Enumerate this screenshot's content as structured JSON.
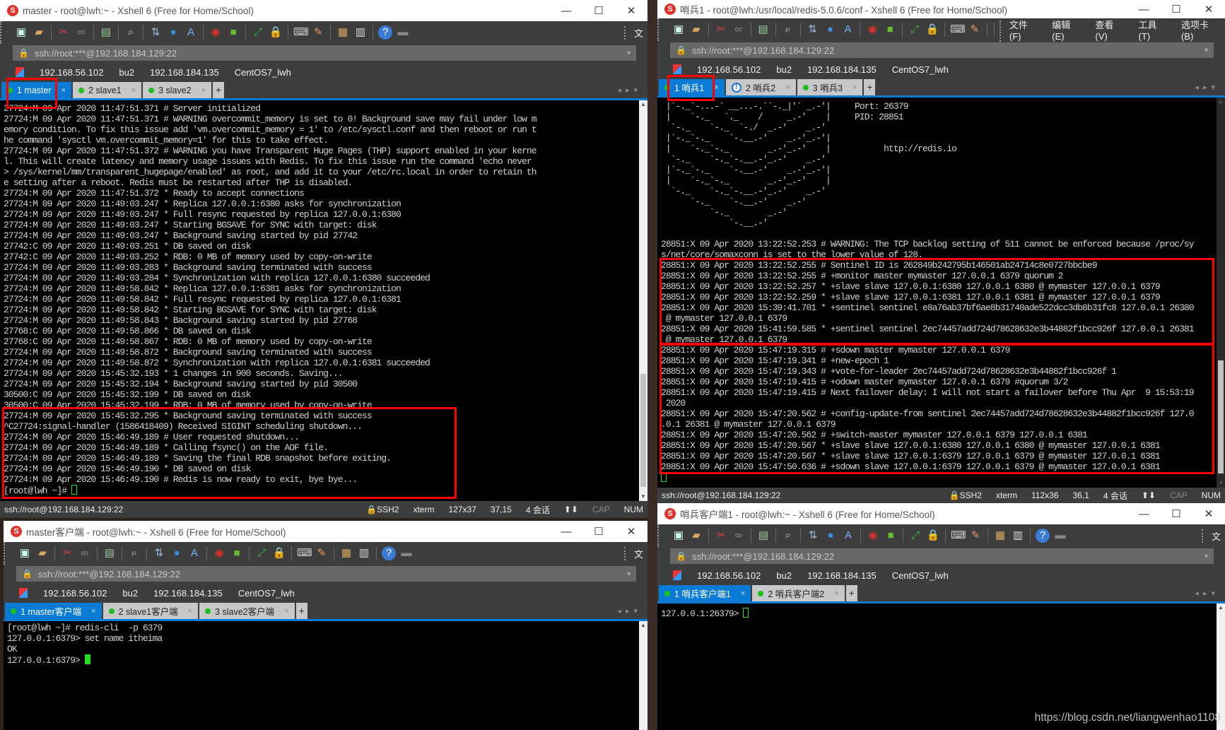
{
  "common": {
    "address": "ssh://root:***@192.168.184.129:22",
    "quick_links": [
      "192.168.56.102",
      "bu2",
      "192.168.184.135",
      "CentOS7_lwh"
    ],
    "window_buttons": {
      "minimize": "—",
      "maximize": "☐",
      "close": "✕"
    },
    "menu_truncated": "文",
    "toolbar_icons": [
      "new-session-icon",
      "open-folder-icon",
      "|",
      "disconnect-icon",
      "reconnect-icon",
      "|",
      "properties-icon",
      "|",
      "find-icon",
      "|",
      "transfer-icon",
      "globe-icon",
      "font-icon",
      "|",
      "xshell-logo-icon",
      "xftp-icon",
      "|",
      "fullscreen-icon",
      "lock-icon",
      "|",
      "keyboard-icon",
      "highlight-icon",
      "|",
      "compose-icon",
      "layout-icon",
      "|",
      "help-icon",
      "chat-icon"
    ],
    "accent_color": "#0a7bd4",
    "highlight_color": "#ff0000",
    "cursor_color": "#1ee01e"
  },
  "windows": [
    {
      "id": "win-master",
      "title": "master - root@lwh:~ - Xshell 6 (Free for Home/School)",
      "tabs": [
        {
          "label": "1 master",
          "active": true,
          "icon": "dot"
        },
        {
          "label": "2 slave1",
          "active": false,
          "icon": "dot"
        },
        {
          "label": "3 slave2",
          "active": false,
          "icon": "dot"
        }
      ],
      "lines": [
        "27724:M 09 Apr 2020 11:47:51.371 # Server initialized",
        "27724:M 09 Apr 2020 11:47:51.371 # WARNING overcommit_memory is set to 0! Background save may fail under low m",
        "emory condition. To fix this issue add 'vm.overcommit_memory = 1' to /etc/sysctl.conf and then reboot or run t",
        "he command 'sysctl vm.overcommit_memory=1' for this to take effect.",
        "27724:M 09 Apr 2020 11:47:51.372 # WARNING you have Transparent Huge Pages (THP) support enabled in your kerne",
        "l. This will create latency and memory usage issues with Redis. To fix this issue run the command 'echo never",
        "> /sys/kernel/mm/transparent_hugepage/enabled' as root, and add it to your /etc/rc.local in order to retain th",
        "e setting after a reboot. Redis must be restarted after THP is disabled.",
        "27724:M 09 Apr 2020 11:47:51.372 * Ready to accept connections",
        "27724:M 09 Apr 2020 11:49:03.247 * Replica 127.0.0.1:6380 asks for synchronization",
        "27724:M 09 Apr 2020 11:49:03.247 * Full resync requested by replica 127.0.0.1:6380",
        "27724:M 09 Apr 2020 11:49:03.247 * Starting BGSAVE for SYNC with target: disk",
        "27724:M 09 Apr 2020 11:49:03.247 * Background saving started by pid 27742",
        "27742:C 09 Apr 2020 11:49:03.251 * DB saved on disk",
        "27742:C 09 Apr 2020 11:49:03.252 * RDB: 0 MB of memory used by copy-on-write",
        "27724:M 09 Apr 2020 11:49:03.283 * Background saving terminated with success",
        "27724:M 09 Apr 2020 11:49:03.284 * Synchronization with replica 127.0.0.1:6380 succeeded",
        "27724:M 09 Apr 2020 11:49:58.842 * Replica 127.0.0.1:6381 asks for synchronization",
        "27724:M 09 Apr 2020 11:49:58.842 * Full resync requested by replica 127.0.0.1:6381",
        "27724:M 09 Apr 2020 11:49:58.842 * Starting BGSAVE for SYNC with target: disk",
        "27724:M 09 Apr 2020 11:49:58.843 * Background saving started by pid 27768",
        "27768:C 09 Apr 2020 11:49:58.866 * DB saved on disk",
        "27768:C 09 Apr 2020 11:49:58.867 * RDB: 0 MB of memory used by copy-on-write",
        "27724:M 09 Apr 2020 11:49:58.872 * Background saving terminated with success",
        "27724:M 09 Apr 2020 11:49:58.872 * Synchronization with replica 127.0.0.1:6381 succeeded",
        "27724:M 09 Apr 2020 15:45:32.193 * 1 changes in 900 seconds. Saving...",
        "27724:M 09 Apr 2020 15:45:32.194 * Background saving started by pid 30500",
        "30500:C 09 Apr 2020 15:45:32.199 * DB saved on disk",
        "30500:C 09 Apr 2020 15:45:32.199 * RDB: 0 MB of memory used by copy-on-write",
        "27724:M 09 Apr 2020 15:45:32.295 * Background saving terminated with success",
        "^C27724:signal-handler (1586418409) Received SIGINT scheduling shutdown...",
        "27724:M 09 Apr 2020 15:46:49.189 # User requested shutdown...",
        "27724:M 09 Apr 2020 15:46:49.189 * Calling fsync() on the AOF file.",
        "27724:M 09 Apr 2020 15:46:49.189 * Saving the final RDB snapshot before exiting.",
        "27724:M 09 Apr 2020 15:46:49.190 * DB saved on disk",
        "27724:M 09 Apr 2020 15:46:49.190 # Redis is now ready to exit, bye bye...",
        "[root@lwh ~]# "
      ],
      "cursor": "hollow",
      "status": {
        "connection": "ssh://root@192.168.184.129:22",
        "protocol": "SSH2",
        "terminal": "xterm",
        "size": "127x37",
        "position": "37,15",
        "sessions": "4 会话",
        "arrows": "⬆⬇",
        "cap": "CAP",
        "num": "NUM"
      }
    },
    {
      "id": "win-sentinel1",
      "title": "哨兵1 - root@lwh:/usr/local/redis-5.0.6/conf - Xshell 6 (Free for Home/School)",
      "menu": [
        "文件(F)",
        "编辑(E)",
        "查看(V)",
        "工具(T)",
        "选项卡(B)"
      ],
      "tabs": [
        {
          "label": "1 哨兵1",
          "active": true,
          "icon": "dot"
        },
        {
          "label": "2 哨兵2",
          "active": false,
          "icon": "info"
        },
        {
          "label": "3 哨兵3",
          "active": false,
          "icon": "dot"
        }
      ],
      "lines": [
        " |`-._`-...-` __...-.``-._|'` _.-'|     Port: 26379",
        " |    `-._   `._    /     _.-'    |     PID: 28851",
        "  `-._    `-._  `-./  _.-'    _.-'",
        " |`-._`-._    `-.__.-'    _.-'_.-'|",
        " |    `-._`-._        _.-'_.-'    |           http://redis.io",
        "  `-._    `-._`-.__.-'_.-'    _.-'",
        " |`-._`-._    `-.__.-'    _.-'_.-'|",
        " |    `-._`-._        _.-'_.-'    |",
        "  `-._    `-._`-.__.-'_.-'    _.-'",
        "      `-._    `-.__.-'    _.-'",
        "          `-._        _.-'",
        "              `-.__.-'",
        "",
        "28851:X 09 Apr 2020 13:22:52.253 # WARNING: The TCP backlog setting of 511 cannot be enforced because /proc/sy",
        "s/net/core/somaxconn is set to the lower value of 128.",
        "28851:X 09 Apr 2020 13:22:52.255 # Sentinel ID is 262849b242795b146501ab24714c8e0727bbcbe9",
        "28851:X 09 Apr 2020 13:22:52.255 # +monitor master mymaster 127.0.0.1 6379 quorum 2",
        "28851:X 09 Apr 2020 13:22:52.257 * +slave slave 127.0.0.1:6380 127.0.0.1 6380 @ mymaster 127.0.0.1 6379",
        "28851:X 09 Apr 2020 13:22:52.259 * +slave slave 127.0.0.1:6381 127.0.0.1 6381 @ mymaster 127.0.0.1 6379",
        "28851:X 09 Apr 2020 15:39:41.701 * +sentinel sentinel e8a76ab37bf6ae8b31740ade522dcc3db8b31fc8 127.0.0.1 26380",
        " @ mymaster 127.0.0.1 6379",
        "28851:X 09 Apr 2020 15:41:59.585 * +sentinel sentinel 2ec74457add724d78628632e3b44882f1bcc926f 127.0.0.1 26381",
        " @ mymaster 127.0.0.1 6379",
        "28851:X 09 Apr 2020 15:47:19.315 # +sdown master mymaster 127.0.0.1 6379",
        "28851:X 09 Apr 2020 15:47:19.341 # +new-epoch 1",
        "28851:X 09 Apr 2020 15:47:19.343 # +vote-for-leader 2ec74457add724d78628632e3b44882f1bcc926f 1",
        "28851:X 09 Apr 2020 15:47:19.415 # +odown master mymaster 127.0.0.1 6379 #quorum 3/2",
        "28851:X 09 Apr 2020 15:47:19.415 # Next failover delay: I will not start a failover before Thu Apr  9 15:53:19",
        " 2020",
        "28851:X 09 Apr 2020 15:47:20.562 # +config-update-from sentinel 2ec74457add724d78628632e3b44882f1bcc926f 127.0",
        ".0.1 26381 @ mymaster 127.0.0.1 6379",
        "28851:X 09 Apr 2020 15:47:20.562 # +switch-master mymaster 127.0.0.1 6379 127.0.0.1 6381",
        "28851:X 09 Apr 2020 15:47:20.567 * +slave slave 127.0.0.1:6380 127.0.0.1 6380 @ mymaster 127.0.0.1 6381",
        "28851:X 09 Apr 2020 15:47:20.567 * +slave slave 127.0.0.1:6379 127.0.0.1 6379 @ mymaster 127.0.0.1 6381",
        "28851:X 09 Apr 2020 15:47:50.636 # +sdown slave 127.0.0.1:6379 127.0.0.1 6379 @ mymaster 127.0.0.1 6381",
        ""
      ],
      "cursor": "hollow",
      "status": {
        "connection": "ssh://root@192.168.184.129:22",
        "protocol": "SSH2",
        "terminal": "xterm",
        "size": "112x36",
        "position": "36,1",
        "sessions": "4 会话",
        "arrows": "⬆⬇",
        "cap": "CAP",
        "num": "NUM"
      }
    },
    {
      "id": "win-client",
      "title": "master客户端 - root@lwh:~ - Xshell 6 (Free for Home/School)",
      "tabs": [
        {
          "label": "1 master客户端",
          "active": true,
          "icon": "dot"
        },
        {
          "label": "2 slave1客户端",
          "active": false,
          "icon": "dot"
        },
        {
          "label": "3 slave2客户端",
          "active": false,
          "icon": "dot"
        }
      ],
      "lines": [
        "[root@lwh ~]# redis-cli  -p 6379",
        "127.0.0.1:6379> set name itheima",
        "OK",
        "127.0.0.1:6379> "
      ],
      "cursor": "solid"
    },
    {
      "id": "win-sclient",
      "title": "哨兵客户端1 - root@lwh:~ - Xshell 6 (Free for Home/School)",
      "tabs": [
        {
          "label": "1 哨兵客户端1",
          "active": true,
          "icon": "dot"
        },
        {
          "label": "2 哨兵客户端2",
          "active": false,
          "icon": "dot"
        }
      ],
      "lines": [
        "127.0.0.1:26379> "
      ],
      "cursor": "hollow",
      "watermark": "https://blog.csdn.net/liangwenhao1108"
    }
  ]
}
